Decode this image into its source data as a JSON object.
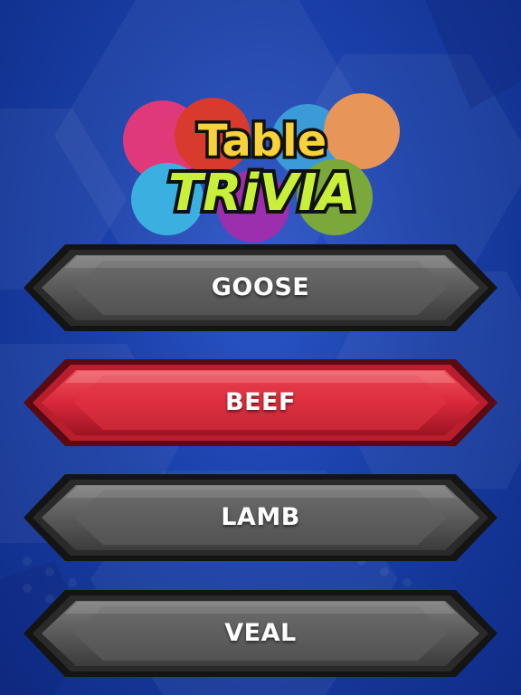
{
  "logo": {
    "line1": "Table",
    "line2": "TRiVIA",
    "circle_colors": [
      "#e0397a",
      "#d93a2e",
      "#3a9bd8",
      "#e8955a",
      "#3bb0e0",
      "#9b2fae",
      "#7aa83a",
      "#f4c430"
    ]
  },
  "answers": [
    {
      "label": "GOOSE",
      "state": "default"
    },
    {
      "label": "BEEF",
      "state": "selected"
    },
    {
      "label": "LAMB",
      "state": "default"
    },
    {
      "label": "VEAL",
      "state": "default"
    }
  ],
  "colors": {
    "background": "#1a3fa8",
    "button_default": "#5a5a5a",
    "button_selected": "#d8283a",
    "button_border": "#111111",
    "label_text": "#ffffff"
  }
}
